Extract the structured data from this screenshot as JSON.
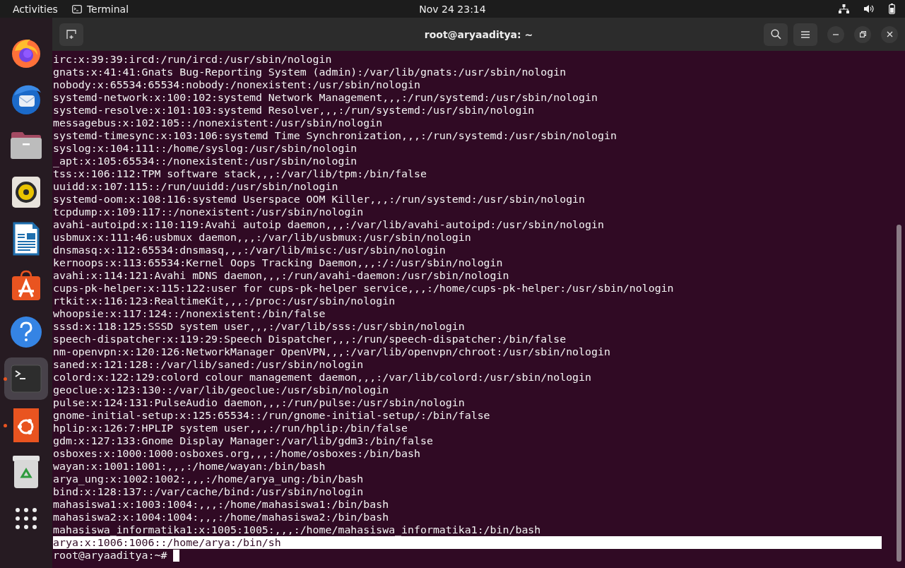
{
  "top_bar": {
    "activities": "Activities",
    "app_name": "Terminal",
    "clock": "Nov 24  23:14"
  },
  "dock": [
    {
      "kind": "firefox",
      "running": false,
      "selected": false
    },
    {
      "kind": "thunderbird",
      "running": false,
      "selected": false
    },
    {
      "kind": "files",
      "running": false,
      "selected": false
    },
    {
      "kind": "music",
      "running": false,
      "selected": false
    },
    {
      "kind": "writer",
      "running": false,
      "selected": false
    },
    {
      "kind": "store",
      "running": false,
      "selected": false
    },
    {
      "kind": "help",
      "running": false,
      "selected": false
    },
    {
      "kind": "terminal",
      "running": true,
      "selected": true
    },
    {
      "kind": "ubuntu",
      "running": true,
      "selected": false
    },
    {
      "kind": "trash",
      "running": false,
      "selected": false
    },
    {
      "kind": "apps",
      "running": false,
      "selected": false
    }
  ],
  "window": {
    "title": "root@aryaaditya: ~"
  },
  "terminal": {
    "lines": [
      {
        "text": "irc:x:39:39:ircd:/run/ircd:/usr/sbin/nologin",
        "selected": false
      },
      {
        "text": "gnats:x:41:41:Gnats Bug-Reporting System (admin):/var/lib/gnats:/usr/sbin/nologin",
        "selected": false
      },
      {
        "text": "nobody:x:65534:65534:nobody:/nonexistent:/usr/sbin/nologin",
        "selected": false
      },
      {
        "text": "systemd-network:x:100:102:systemd Network Management,,,:/run/systemd:/usr/sbin/nologin",
        "selected": false
      },
      {
        "text": "systemd-resolve:x:101:103:systemd Resolver,,,:/run/systemd:/usr/sbin/nologin",
        "selected": false
      },
      {
        "text": "messagebus:x:102:105::/nonexistent:/usr/sbin/nologin",
        "selected": false
      },
      {
        "text": "systemd-timesync:x:103:106:systemd Time Synchronization,,,:/run/systemd:/usr/sbin/nologin",
        "selected": false
      },
      {
        "text": "syslog:x:104:111::/home/syslog:/usr/sbin/nologin",
        "selected": false
      },
      {
        "text": "_apt:x:105:65534::/nonexistent:/usr/sbin/nologin",
        "selected": false
      },
      {
        "text": "tss:x:106:112:TPM software stack,,,:/var/lib/tpm:/bin/false",
        "selected": false
      },
      {
        "text": "uuidd:x:107:115::/run/uuidd:/usr/sbin/nologin",
        "selected": false
      },
      {
        "text": "systemd-oom:x:108:116:systemd Userspace OOM Killer,,,:/run/systemd:/usr/sbin/nologin",
        "selected": false
      },
      {
        "text": "tcpdump:x:109:117::/nonexistent:/usr/sbin/nologin",
        "selected": false
      },
      {
        "text": "avahi-autoipd:x:110:119:Avahi autoip daemon,,,:/var/lib/avahi-autoipd:/usr/sbin/nologin",
        "selected": false
      },
      {
        "text": "usbmux:x:111:46:usbmux daemon,,,:/var/lib/usbmux:/usr/sbin/nologin",
        "selected": false
      },
      {
        "text": "dnsmasq:x:112:65534:dnsmasq,,,:/var/lib/misc:/usr/sbin/nologin",
        "selected": false
      },
      {
        "text": "kernoops:x:113:65534:Kernel Oops Tracking Daemon,,,:/:/usr/sbin/nologin",
        "selected": false
      },
      {
        "text": "avahi:x:114:121:Avahi mDNS daemon,,,:/run/avahi-daemon:/usr/sbin/nologin",
        "selected": false
      },
      {
        "text": "cups-pk-helper:x:115:122:user for cups-pk-helper service,,,:/home/cups-pk-helper:/usr/sbin/nologin",
        "selected": false
      },
      {
        "text": "rtkit:x:116:123:RealtimeKit,,,:/proc:/usr/sbin/nologin",
        "selected": false
      },
      {
        "text": "whoopsie:x:117:124::/nonexistent:/bin/false",
        "selected": false
      },
      {
        "text": "sssd:x:118:125:SSSD system user,,,:/var/lib/sss:/usr/sbin/nologin",
        "selected": false
      },
      {
        "text": "speech-dispatcher:x:119:29:Speech Dispatcher,,,:/run/speech-dispatcher:/bin/false",
        "selected": false
      },
      {
        "text": "nm-openvpn:x:120:126:NetworkManager OpenVPN,,,:/var/lib/openvpn/chroot:/usr/sbin/nologin",
        "selected": false
      },
      {
        "text": "saned:x:121:128::/var/lib/saned:/usr/sbin/nologin",
        "selected": false
      },
      {
        "text": "colord:x:122:129:colord colour management daemon,,,:/var/lib/colord:/usr/sbin/nologin",
        "selected": false
      },
      {
        "text": "geoclue:x:123:130::/var/lib/geoclue:/usr/sbin/nologin",
        "selected": false
      },
      {
        "text": "pulse:x:124:131:PulseAudio daemon,,,:/run/pulse:/usr/sbin/nologin",
        "selected": false
      },
      {
        "text": "gnome-initial-setup:x:125:65534::/run/gnome-initial-setup/:/bin/false",
        "selected": false
      },
      {
        "text": "hplip:x:126:7:HPLIP system user,,,:/run/hplip:/bin/false",
        "selected": false
      },
      {
        "text": "gdm:x:127:133:Gnome Display Manager:/var/lib/gdm3:/bin/false",
        "selected": false
      },
      {
        "text": "osboxes:x:1000:1000:osboxes.org,,,:/home/osboxes:/bin/bash",
        "selected": false
      },
      {
        "text": "wayan:x:1001:1001:,,,:/home/wayan:/bin/bash",
        "selected": false
      },
      {
        "text": "arya_ung:x:1002:1002:,,,:/home/arya_ung:/bin/bash",
        "selected": false
      },
      {
        "text": "bind:x:128:137::/var/cache/bind:/usr/sbin/nologin",
        "selected": false
      },
      {
        "text": "mahasiswa1:x:1003:1004:,,,:/home/mahasiswa1:/bin/bash",
        "selected": false
      },
      {
        "text": "mahasiswa2:x:1004:1004:,,,:/home/mahasiswa2:/bin/bash",
        "selected": false
      },
      {
        "text": "mahasiswa_informatika1:x:1005:1005:,,,:/home/mahasiswa_informatika1:/bin/bash",
        "selected": false
      },
      {
        "text": "arya:x:1006:1006::/home/arya:/bin/sh",
        "selected": true
      }
    ],
    "prompt": "root@aryaaditya:~#"
  }
}
